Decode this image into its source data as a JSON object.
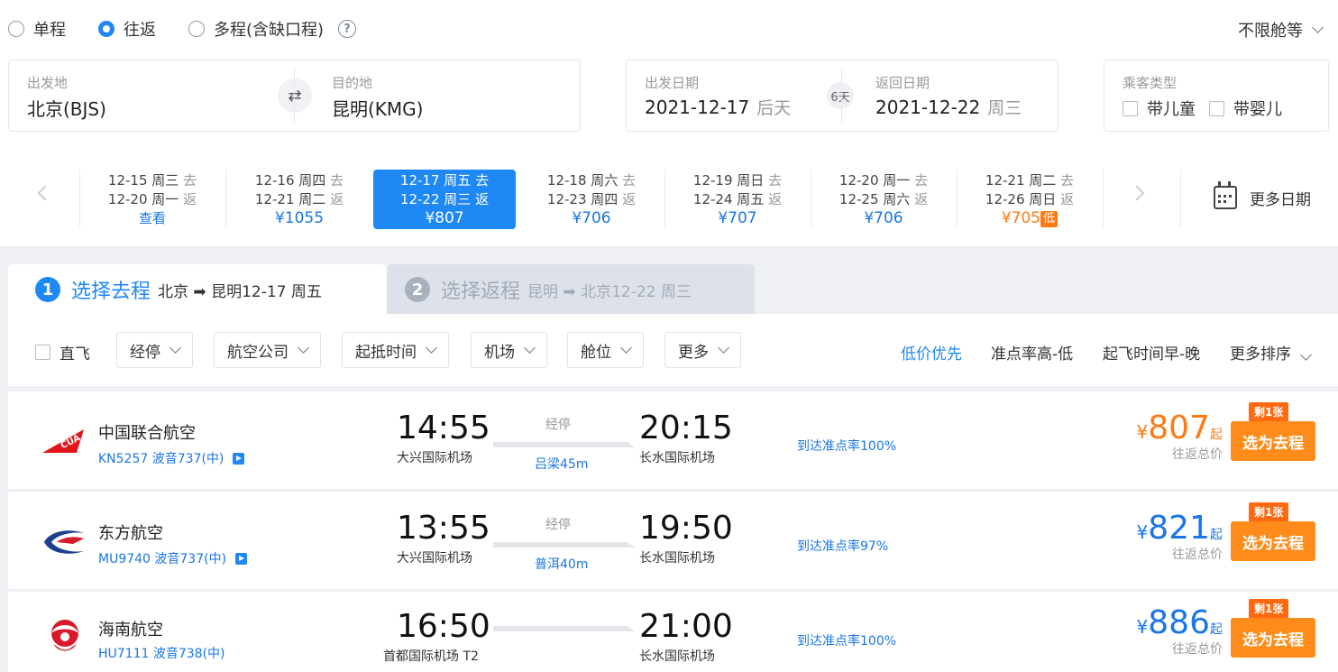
{
  "trip_types": [
    {
      "label": "单程",
      "selected": false
    },
    {
      "label": "往返",
      "selected": true
    },
    {
      "label": "多程(含缺口程)",
      "selected": false
    }
  ],
  "cabin_select": "不限舱等",
  "origin": {
    "label": "出发地",
    "value": "北京(BJS)"
  },
  "destination": {
    "label": "目的地",
    "value": "昆明(KMG)"
  },
  "depart_date": {
    "label": "出发日期",
    "value": "2021-12-17",
    "note": "后天"
  },
  "return_date": {
    "label": "返回日期",
    "value": "2021-12-22",
    "note": "周三"
  },
  "trip_days": "6天",
  "passenger": {
    "label": "乘客类型",
    "child": "带儿童",
    "infant": "带婴儿"
  },
  "date_strip": [
    {
      "go": "12-15 周三",
      "go_tag": "去",
      "back": "12-20 周一",
      "back_tag": "返",
      "price": "查看",
      "active": false
    },
    {
      "go": "12-16 周四",
      "go_tag": "去",
      "back": "12-21 周二",
      "back_tag": "返",
      "price": "¥1055",
      "active": false
    },
    {
      "go": "12-17 周五",
      "go_tag": "去",
      "back": "12-22 周三",
      "back_tag": "返",
      "price": "¥807",
      "active": true
    },
    {
      "go": "12-18 周六",
      "go_tag": "去",
      "back": "12-23 周四",
      "back_tag": "返",
      "price": "¥706",
      "active": false
    },
    {
      "go": "12-19 周日",
      "go_tag": "去",
      "back": "12-24 周五",
      "back_tag": "返",
      "price": "¥707",
      "active": false
    },
    {
      "go": "12-20 周一",
      "go_tag": "去",
      "back": "12-25 周六",
      "back_tag": "返",
      "price": "¥706",
      "active": false
    },
    {
      "go": "12-21 周二",
      "go_tag": "去",
      "back": "12-26 周日",
      "back_tag": "返",
      "price": "¥705",
      "low_tag": "低",
      "active": false
    }
  ],
  "more_dates": "更多日期",
  "steps": [
    {
      "num": "1",
      "title": "选择去程",
      "route": "北京 ➡ 昆明12-17 周五"
    },
    {
      "num": "2",
      "title": "选择返程",
      "route": "昆明 ➡ 北京12-22 周三"
    }
  ],
  "filters": {
    "direct": "直飞",
    "buttons": [
      "经停",
      "航空公司",
      "起抵时间",
      "机场",
      "舱位",
      "更多"
    ],
    "sorts": [
      "低价优先",
      "准点率高-低",
      "起飞时间早-晚",
      "更多排序"
    ]
  },
  "flights": [
    {
      "airline": "中国联合航空",
      "flight_no": "KN5257 波音737(中)",
      "dep_time": "14:55",
      "dep_airport": "大兴国际机场",
      "stop_label": "经停",
      "stop_city": "吕梁45m",
      "arr_time": "20:15",
      "arr_airport": "长水国际机场",
      "ontime": "到达准点率100%",
      "price_yen": "¥",
      "price": "807",
      "price_suffix": "起",
      "price_note": "往返总价",
      "seat_tag": "剩1张",
      "button": "选为去程"
    },
    {
      "airline": "东方航空",
      "flight_no": "MU9740 波音737(中)",
      "dep_time": "13:55",
      "dep_airport": "大兴国际机场",
      "stop_label": "经停",
      "stop_city": "普洱40m",
      "arr_time": "19:50",
      "arr_airport": "长水国际机场",
      "ontime": "到达准点率97%",
      "price_yen": "¥",
      "price": "821",
      "price_suffix": "起",
      "price_note": "往返总价",
      "seat_tag": "剩1张",
      "button": "选为去程"
    },
    {
      "airline": "海南航空",
      "flight_no": "HU7111 波音738(中)",
      "dep_time": "16:50",
      "dep_airport": "首都国际机场",
      "dep_terminal": "T2",
      "arr_time": "21:00",
      "arr_airport": "长水国际机场",
      "ontime": "到达准点率100%",
      "price_yen": "¥",
      "price": "886",
      "price_suffix": "起",
      "price_note": "往返总价",
      "seat_tag": "剩1张",
      "button": "选为去程"
    }
  ],
  "colors": {
    "accent": "#1e88f5",
    "orange": "#ff7a14",
    "price_blue": "#1a75e6"
  },
  "icons": [
    "help-icon",
    "swap-icon",
    "calendar-icon",
    "play-icon",
    "chevron-down-icon"
  ]
}
